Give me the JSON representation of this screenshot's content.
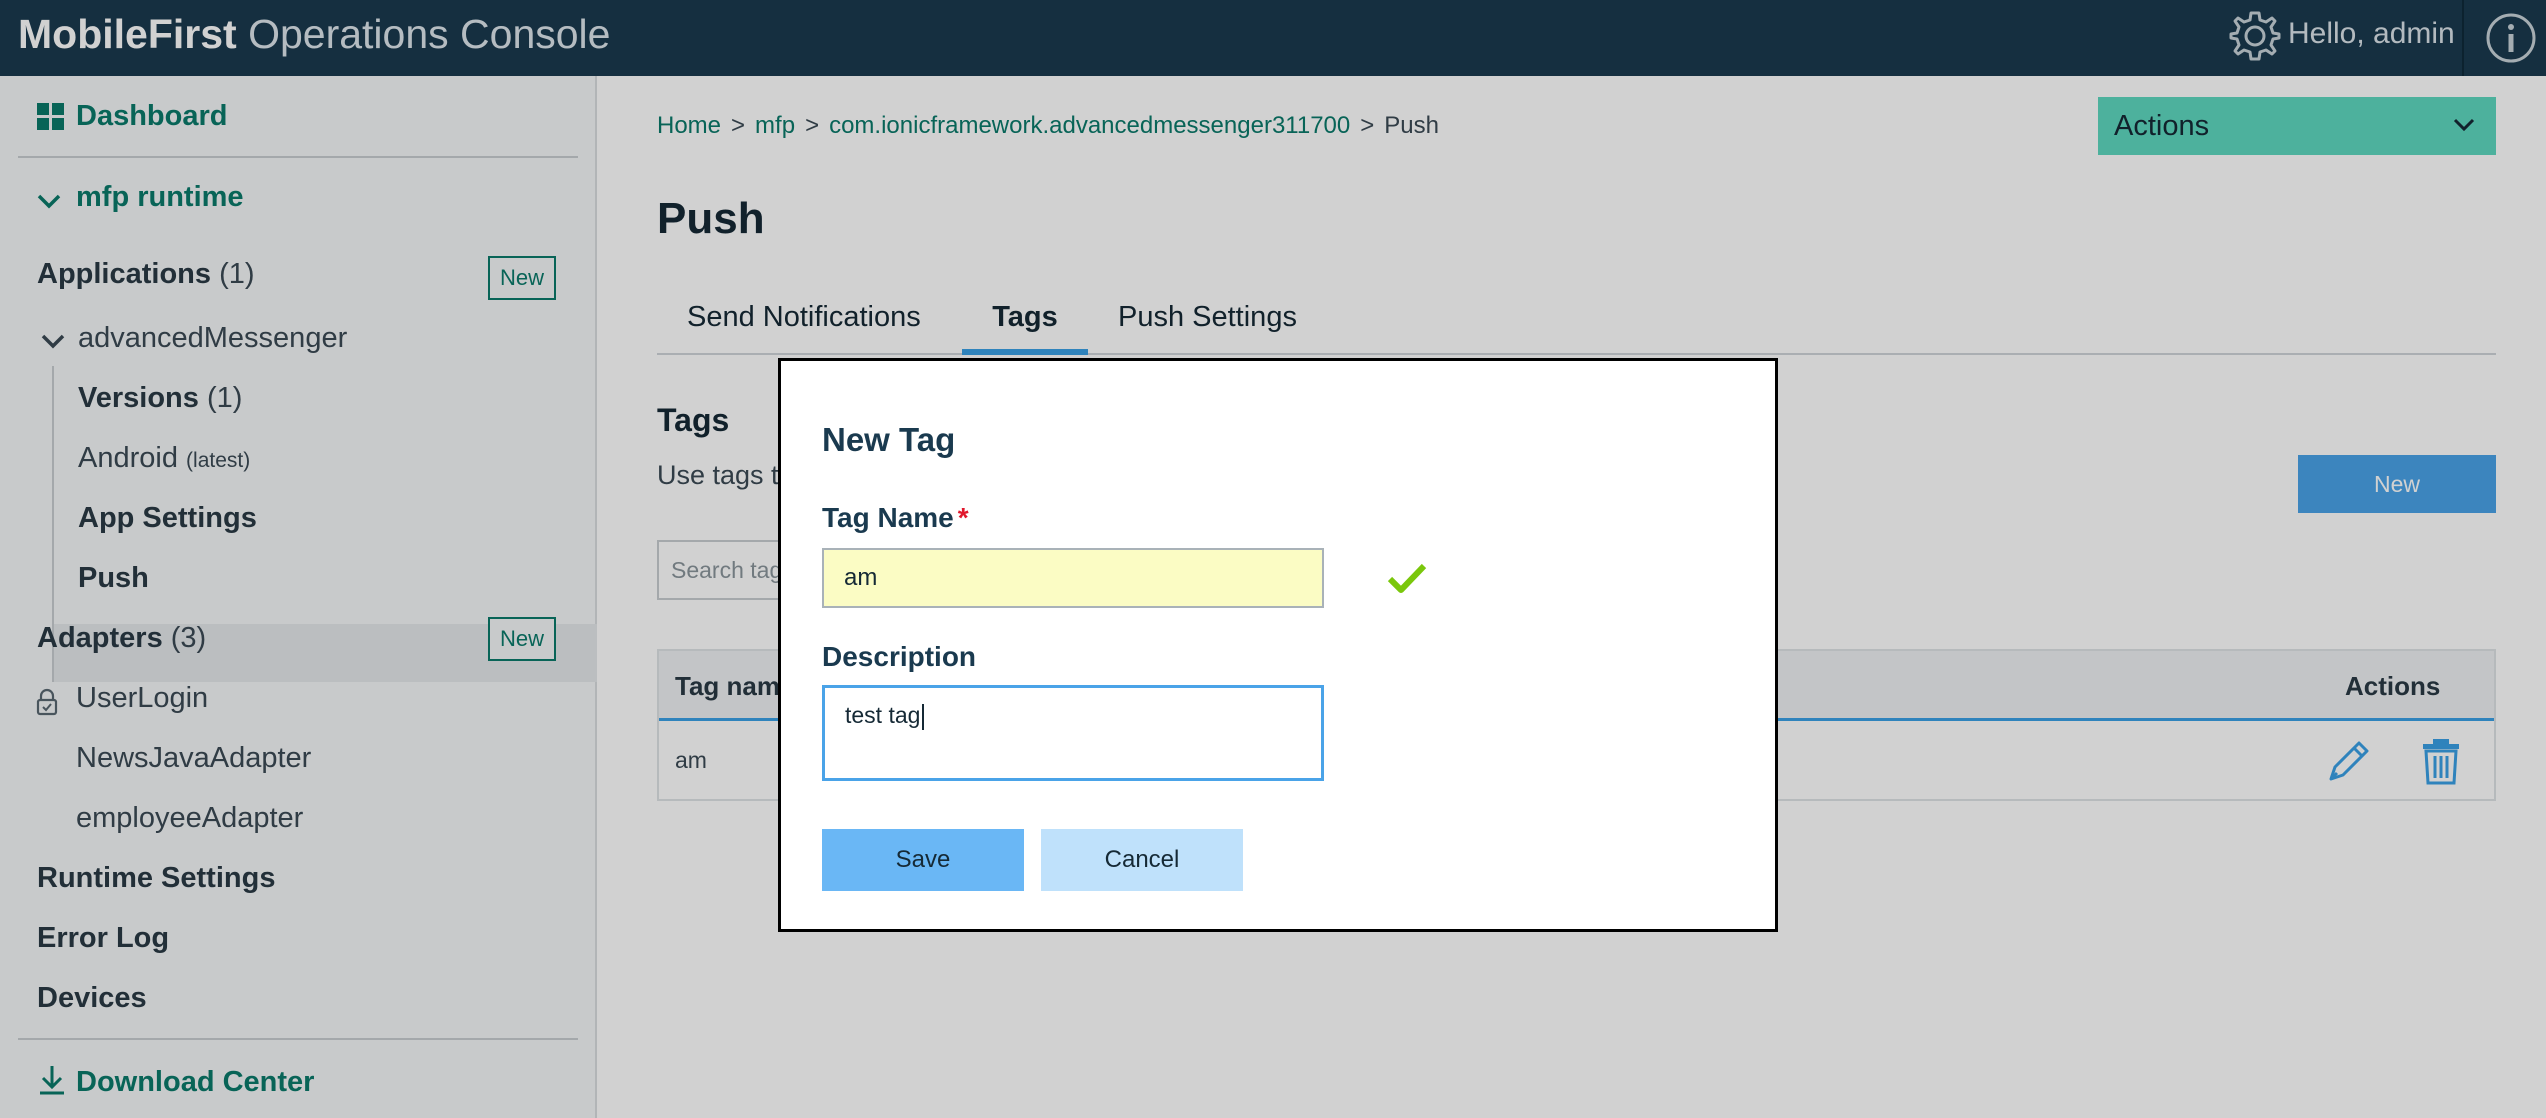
{
  "header": {
    "brand_bold": "MobileFirst",
    "brand_rest": "Operations Console",
    "greeting": "Hello, admin"
  },
  "sidebar": {
    "dashboard": "Dashboard",
    "runtime": "mfp runtime",
    "applications_label": "Applications",
    "applications_count": "(1)",
    "new_label": "New",
    "app_name": "advancedMessenger",
    "versions_label": "Versions",
    "versions_count": "(1)",
    "android_label": "Android",
    "android_tag": "(latest)",
    "app_settings": "App Settings",
    "push": "Push",
    "adapters_label": "Adapters",
    "adapters_count": "(3)",
    "adapters": [
      "UserLogin",
      "NewsJavaAdapter",
      "employeeAdapter"
    ],
    "runtime_settings": "Runtime Settings",
    "error_log": "Error Log",
    "devices": "Devices",
    "download_center": "Download Center"
  },
  "breadcrumb": {
    "items": [
      "Home",
      "mfp",
      "com.ionicframework.advancedmessenger311700"
    ],
    "current": "Push",
    "separator": ">"
  },
  "actions_dropdown": "Actions",
  "page_title": "Push",
  "tabs": [
    "Send Notifications",
    "Tags",
    "Push Settings"
  ],
  "active_tab": "Tags",
  "section": {
    "title": "Tags",
    "description": "Use tags t",
    "new_button": "New",
    "search_placeholder": "Search tag"
  },
  "table": {
    "columns": [
      "Tag nam",
      "Actions"
    ],
    "rows": [
      {
        "tag": "am"
      }
    ]
  },
  "modal": {
    "title": "New Tag",
    "tag_name_label": "Tag Name",
    "required_mark": "*",
    "tag_name_value": "am",
    "description_label": "Description",
    "description_value": "test tag",
    "save": "Save",
    "cancel": "Cancel"
  },
  "colors": {
    "topbar": "#1a3a4f",
    "link": "#0a7a6b",
    "accent": "#3aa0e6",
    "actions": "#5fd8c0",
    "valid": "#7ac70c"
  }
}
